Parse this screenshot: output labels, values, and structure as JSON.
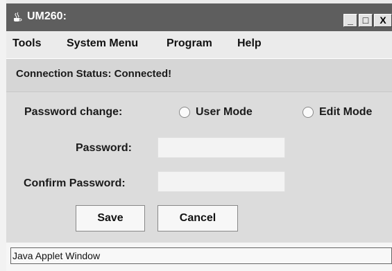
{
  "window": {
    "title": "UM260:"
  },
  "window_buttons": {
    "minimize": "_",
    "maximize": "□",
    "close": "X"
  },
  "menubar": {
    "items": [
      "Tools",
      "System Menu",
      "Program",
      "Help"
    ]
  },
  "status": {
    "text": "Connection Status: Connected!"
  },
  "form": {
    "password_change_label": "Password change:",
    "radio_user_label": "User Mode",
    "radio_edit_label": "Edit Mode",
    "password_label": "Password:",
    "confirm_password_label": "Confirm Password:",
    "password_value": "",
    "confirm_password_value": "",
    "save_label": "Save",
    "cancel_label": "Cancel"
  },
  "footer": {
    "text": "Java Applet Window"
  },
  "colors": {
    "titlebar": "#5e5e5e",
    "panel": "#dcdcdc",
    "status_bar": "#d6d6d6"
  }
}
